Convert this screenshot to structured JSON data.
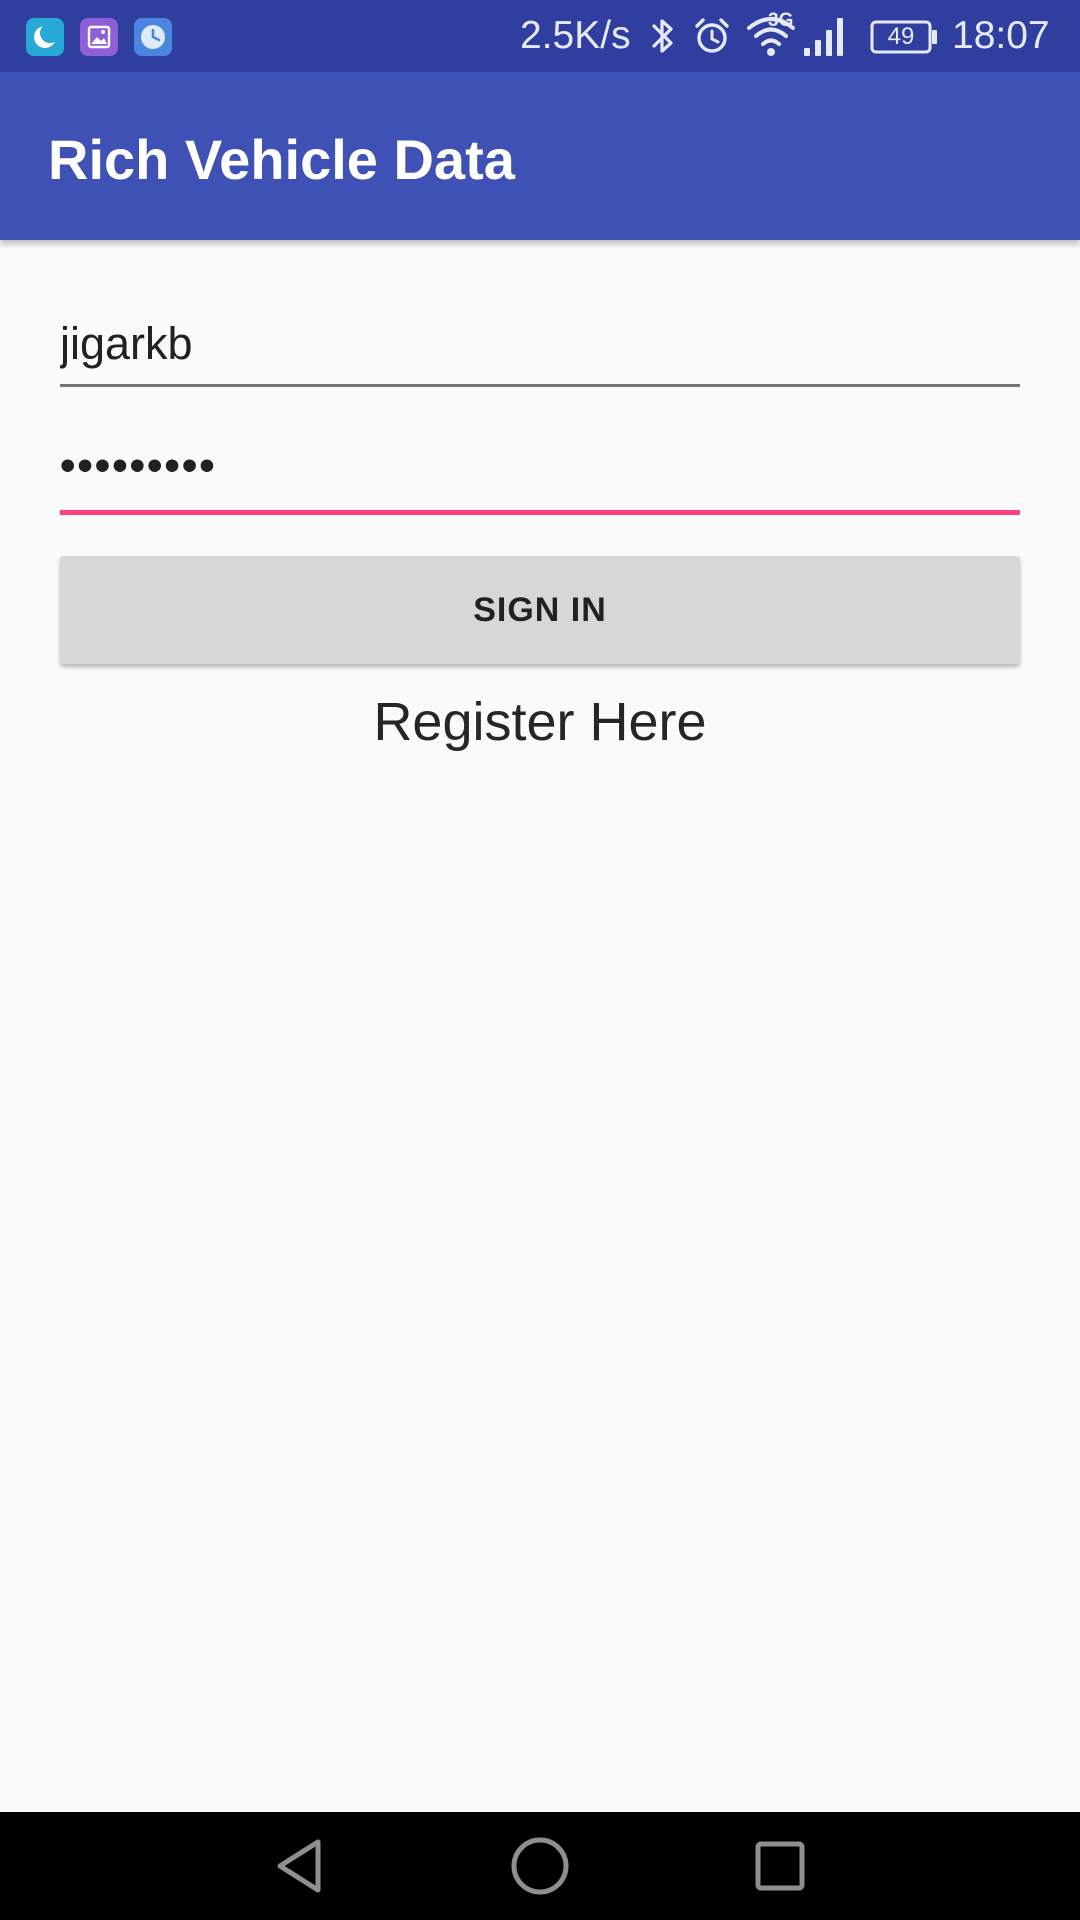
{
  "status_bar": {
    "network_speed": "2.5K/s",
    "network_type": "3G",
    "battery_level": "49",
    "time": "18:07",
    "notification_icons": [
      "moon-app-icon",
      "gallery-app-icon",
      "clock-app-icon"
    ],
    "system_icons": [
      "bluetooth-icon",
      "alarm-icon",
      "wifi-icon",
      "signal-icon",
      "battery-icon"
    ]
  },
  "app_bar": {
    "title": "Rich Vehicle Data"
  },
  "login_form": {
    "username_value": "jigarkb",
    "password_value": "•••••••••",
    "sign_in_label": "SIGN IN",
    "register_label": "Register Here"
  },
  "nav_bar": {
    "buttons": [
      "back-icon",
      "home-icon",
      "recents-icon"
    ]
  },
  "colors": {
    "status_bar": "#303f9f",
    "app_bar": "#3f51b5",
    "accent": "#ff4081",
    "button": "#d6d7d7",
    "background": "#fafafa"
  }
}
